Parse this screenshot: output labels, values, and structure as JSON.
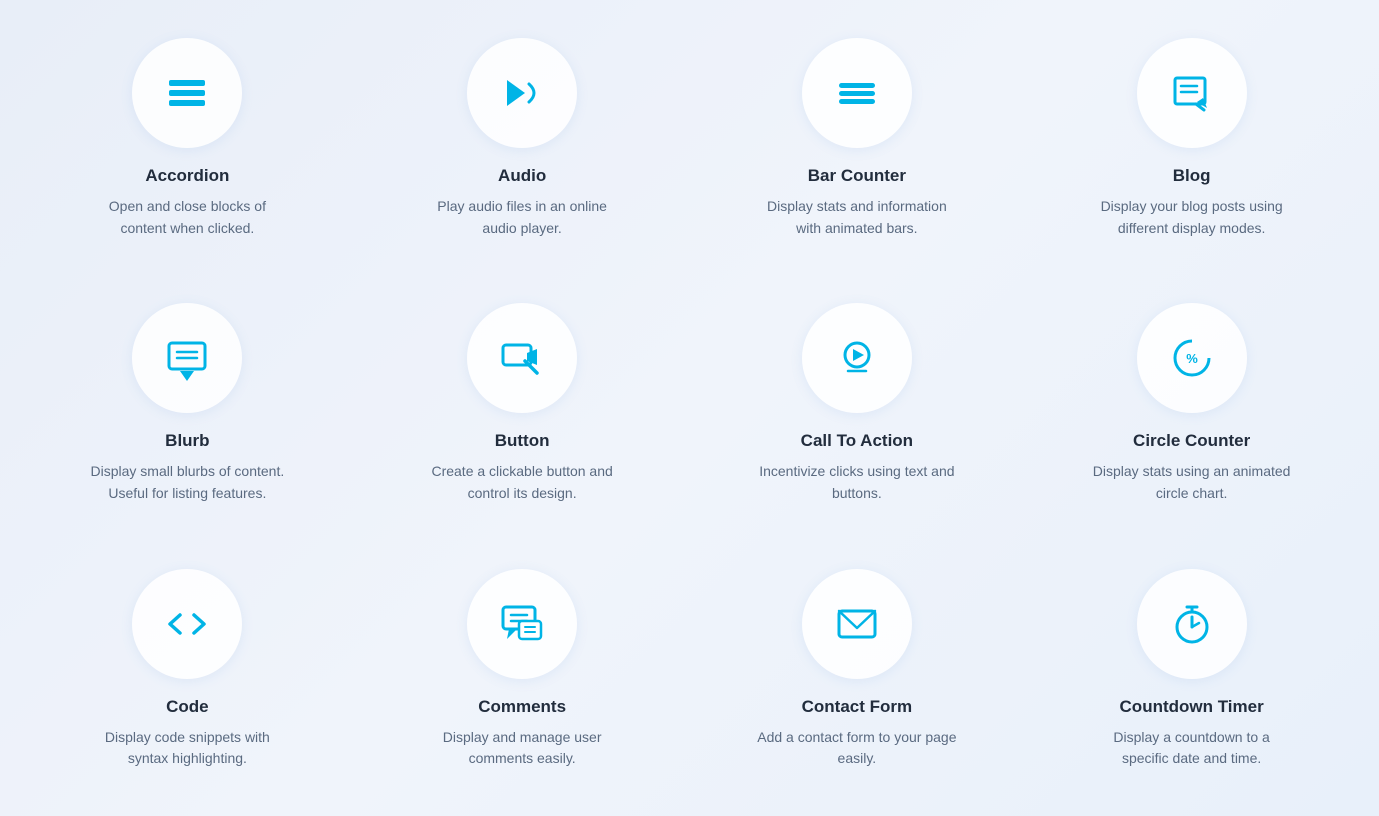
{
  "widgets": [
    {
      "id": "accordion",
      "title": "Accordion",
      "desc": "Open and close blocks of content when clicked.",
      "icon": "accordion"
    },
    {
      "id": "audio",
      "title": "Audio",
      "desc": "Play audio files in an online audio player.",
      "icon": "audio"
    },
    {
      "id": "bar-counter",
      "title": "Bar Counter",
      "desc": "Display stats and information with animated bars.",
      "icon": "bar-counter"
    },
    {
      "id": "blog",
      "title": "Blog",
      "desc": "Display your blog posts using different display modes.",
      "icon": "blog"
    },
    {
      "id": "blurb",
      "title": "Blurb",
      "desc": "Display small blurbs of content. Useful for listing features.",
      "icon": "blurb"
    },
    {
      "id": "button",
      "title": "Button",
      "desc": "Create a clickable button and control its design.",
      "icon": "button"
    },
    {
      "id": "call-to-action",
      "title": "Call To Action",
      "desc": "Incentivize clicks using text and buttons.",
      "icon": "call-to-action"
    },
    {
      "id": "circle-counter",
      "title": "Circle Counter",
      "desc": "Display stats using an animated circle chart.",
      "icon": "circle-counter"
    },
    {
      "id": "code",
      "title": "Code",
      "desc": "Display code snippets with syntax highlighting.",
      "icon": "code"
    },
    {
      "id": "comments",
      "title": "Comments",
      "desc": "Display and manage user comments easily.",
      "icon": "comments"
    },
    {
      "id": "contact-form",
      "title": "Contact Form",
      "desc": "Add a contact form to your page easily.",
      "icon": "contact-form"
    },
    {
      "id": "countdown-timer",
      "title": "Countdown Timer",
      "desc": "Display a countdown to a specific date and time.",
      "icon": "countdown-timer"
    }
  ]
}
